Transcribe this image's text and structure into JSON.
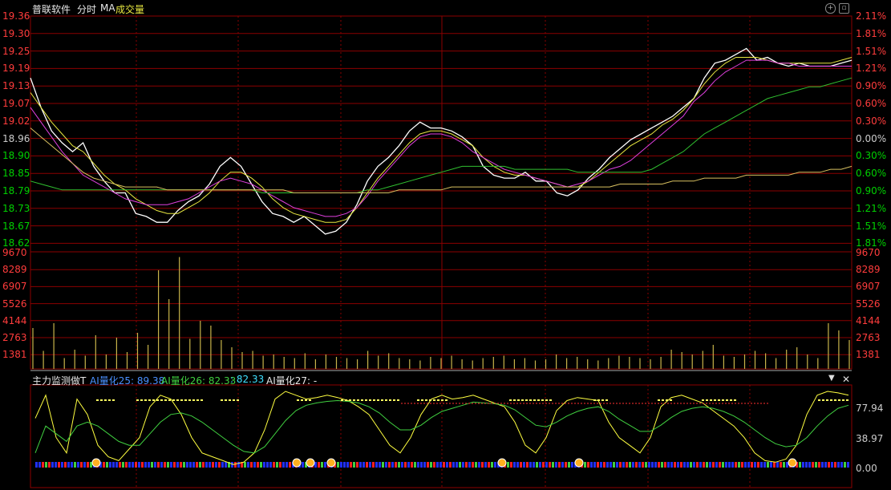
{
  "header": {
    "stock_name": "普联软件",
    "mode": "分时",
    "ma_label": "MA",
    "volume_label": "成交量",
    "settings_icon": "settings-circle-icon",
    "panel_toggle_icon": "panel-toggle-icon"
  },
  "price_axis": {
    "left_labels": [
      "19.36",
      "19.30",
      "19.25",
      "19.19",
      "19.13",
      "19.07",
      "19.02",
      "18.96",
      "18.90",
      "18.85",
      "18.79",
      "18.73",
      "18.67",
      "18.62"
    ],
    "right_labels": [
      "2.11%",
      "1.81%",
      "1.51%",
      "1.21%",
      "0.90%",
      "0.60%",
      "0.30%",
      "0.00%",
      "0.30%",
      "0.60%",
      "0.90%",
      "1.21%",
      "1.51%",
      "1.81%"
    ],
    "colors": {
      "up": "#ff3c3c",
      "flat": "#cccccc",
      "down": "#00d000"
    }
  },
  "volume_axis": {
    "labels": [
      "9670",
      "8289",
      "6907",
      "5526",
      "4144",
      "2763",
      "1381"
    ]
  },
  "indicator": {
    "name": "主力监测做T",
    "ai25_label": "AI量化25: 89.38",
    "ai26_label": "AI量化26: 82.33",
    "ai26_extra": ": 82.33",
    "ai27_label": "AI量化27: -",
    "axis_labels": [
      "77.94",
      "38.97",
      "0.00"
    ],
    "dropdown_icon": "triangle-down-icon",
    "close_icon": "close-icon"
  },
  "colors": {
    "grid": "#8b0000",
    "price_line": "#ffffff",
    "ma_yellow": "#e8e840",
    "ma_magenta": "#e040e0",
    "ma_green": "#30c030",
    "avg_yellow": "#d8c060",
    "volume_bar": "#c8b44a",
    "ind_yellow": "#ffff40",
    "ind_cyan": "#40e0ff",
    "ind_blue": "#2030ff",
    "ind_green": "#40d040"
  },
  "chart_data": {
    "type": "line",
    "title": "",
    "ylabel": "",
    "ylim": [
      18.56,
      19.36
    ],
    "prev_close": 18.96,
    "series": [
      {
        "values": [
          19.15,
          19.05,
          18.97,
          18.93,
          18.9,
          18.93,
          18.85,
          18.8,
          18.76,
          18.76,
          18.69,
          18.68,
          18.66,
          18.66,
          18.7,
          18.73,
          18.75,
          18.79,
          18.85,
          18.88,
          18.85,
          18.79,
          18.73,
          18.69,
          18.68,
          18.66,
          18.68,
          18.65,
          18.62,
          18.63,
          18.66,
          18.72,
          18.8,
          18.85,
          18.88,
          18.92,
          18.97,
          19.0,
          18.98,
          18.98,
          18.97,
          18.95,
          18.92,
          18.85,
          18.82,
          18.81,
          18.81,
          18.83,
          18.8,
          18.8,
          18.76,
          18.75,
          18.77,
          18.81,
          18.84,
          18.88,
          18.91,
          18.94,
          18.96,
          18.98,
          19.0,
          19.02,
          19.05,
          19.08,
          19.15,
          19.2,
          19.21,
          19.23,
          19.25,
          19.21,
          19.22,
          19.2,
          19.19,
          19.2,
          19.19,
          19.19,
          19.19,
          19.2,
          19.21
        ]
      },
      {
        "values": [
          19.1,
          19.05,
          19.0,
          18.96,
          18.92,
          18.9,
          18.86,
          18.82,
          18.79,
          18.77,
          18.74,
          18.72,
          18.7,
          18.69,
          18.69,
          18.71,
          18.73,
          18.76,
          18.8,
          18.83,
          18.83,
          18.81,
          18.78,
          18.74,
          18.71,
          18.69,
          18.68,
          18.67,
          18.66,
          18.66,
          18.67,
          18.71,
          18.76,
          18.81,
          18.85,
          18.89,
          18.93,
          18.96,
          18.97,
          18.97,
          18.96,
          18.94,
          18.92,
          18.88,
          18.85,
          18.83,
          18.82,
          18.82,
          18.81,
          18.8,
          18.79,
          18.78,
          18.78,
          18.8,
          18.83,
          18.86,
          18.89,
          18.92,
          18.94,
          18.96,
          18.99,
          19.01,
          19.04,
          19.08,
          19.13,
          19.17,
          19.2,
          19.22,
          19.22,
          19.22,
          19.21,
          19.2,
          19.2,
          19.2,
          19.2,
          19.2,
          19.2,
          19.21,
          19.22
        ]
      },
      {
        "values": [
          19.05,
          19.0,
          18.95,
          18.9,
          18.86,
          18.82,
          18.8,
          18.78,
          18.76,
          18.74,
          18.73,
          18.72,
          18.72,
          18.72,
          18.73,
          18.74,
          18.76,
          18.78,
          18.8,
          18.81,
          18.8,
          18.79,
          18.77,
          18.75,
          18.73,
          18.71,
          18.7,
          18.69,
          18.68,
          18.68,
          18.69,
          18.71,
          18.75,
          18.8,
          18.84,
          18.88,
          18.92,
          18.95,
          18.96,
          18.96,
          18.95,
          18.93,
          18.9,
          18.88,
          18.86,
          18.84,
          18.83,
          18.82,
          18.81,
          18.8,
          18.79,
          18.78,
          18.79,
          18.8,
          18.82,
          18.84,
          18.85,
          18.87,
          18.9,
          18.93,
          18.96,
          18.99,
          19.02,
          19.07,
          19.1,
          19.14,
          19.17,
          19.19,
          19.21,
          19.21,
          19.21,
          19.2,
          19.2,
          19.19,
          19.19,
          19.19,
          19.19,
          19.19,
          19.19
        ]
      },
      {
        "values": [
          18.8,
          18.79,
          18.78,
          18.77,
          18.77,
          18.77,
          18.77,
          18.77,
          18.77,
          18.77,
          18.77,
          18.77,
          18.77,
          18.77,
          18.77,
          18.77,
          18.77,
          18.77,
          18.77,
          18.77,
          18.77,
          18.77,
          18.76,
          18.76,
          18.76,
          18.76,
          18.76,
          18.76,
          18.76,
          18.76,
          18.76,
          18.76,
          18.77,
          18.77,
          18.78,
          18.79,
          18.8,
          18.81,
          18.82,
          18.83,
          18.84,
          18.85,
          18.85,
          18.85,
          18.85,
          18.85,
          18.84,
          18.84,
          18.84,
          18.84,
          18.84,
          18.84,
          18.83,
          18.83,
          18.83,
          18.83,
          18.83,
          18.83,
          18.83,
          18.84,
          18.86,
          18.88,
          18.9,
          18.93,
          18.96,
          18.98,
          19.0,
          19.02,
          19.04,
          19.06,
          19.08,
          19.09,
          19.1,
          19.11,
          19.12,
          19.12,
          19.13,
          19.14,
          19.15
        ]
      },
      {
        "values": [
          18.98,
          18.95,
          18.92,
          18.89,
          18.86,
          18.83,
          18.81,
          18.8,
          18.79,
          18.78,
          18.78,
          18.78,
          18.78,
          18.77,
          18.77,
          18.77,
          18.77,
          18.77,
          18.77,
          18.77,
          18.77,
          18.77,
          18.77,
          18.77,
          18.77,
          18.76,
          18.76,
          18.76,
          18.76,
          18.76,
          18.76,
          18.76,
          18.76,
          18.76,
          18.76,
          18.77,
          18.77,
          18.77,
          18.77,
          18.77,
          18.78,
          18.78,
          18.78,
          18.78,
          18.78,
          18.78,
          18.78,
          18.78,
          18.78,
          18.78,
          18.78,
          18.78,
          18.78,
          18.78,
          18.78,
          18.78,
          18.79,
          18.79,
          18.79,
          18.79,
          18.79,
          18.8,
          18.8,
          18.8,
          18.81,
          18.81,
          18.81,
          18.81,
          18.82,
          18.82,
          18.82,
          18.82,
          18.82,
          18.83,
          18.83,
          18.83,
          18.84,
          18.84,
          18.85
        ]
      }
    ],
    "volume": [
      3400,
      1500,
      3800,
      900,
      1600,
      1100,
      2800,
      1200,
      2600,
      1400,
      3000,
      2000,
      8200,
      5800,
      9300,
      2500,
      4000,
      3600,
      2400,
      1800,
      1400,
      1500,
      1100,
      1200,
      1000,
      900,
      1300,
      800,
      1200,
      1000,
      900,
      800,
      1500,
      1100,
      1300,
      900,
      800,
      700,
      1000,
      900,
      1100,
      800,
      700,
      900,
      1000,
      1100,
      800,
      900,
      700,
      800,
      1200,
      900,
      1000,
      800,
      700,
      900,
      1100,
      1000,
      900,
      800,
      1000,
      1600,
      1400,
      1200,
      1500,
      2000,
      1100,
      1000,
      1200,
      1500,
      1300,
      900,
      1600,
      1800,
      1200,
      900,
      3800,
      3200,
      2400
    ],
    "indicator_series": [
      {
        "values": [
          65,
          95,
          40,
          20,
          90,
          70,
          30,
          15,
          10,
          25,
          40,
          80,
          95,
          90,
          70,
          40,
          20,
          15,
          10,
          5,
          8,
          20,
          50,
          90,
          100,
          95,
          90,
          92,
          95,
          92,
          88,
          80,
          70,
          50,
          30,
          20,
          40,
          70,
          90,
          95,
          90,
          92,
          95,
          90,
          85,
          80,
          60,
          30,
          20,
          40,
          75,
          88,
          92,
          90,
          88,
          60,
          40,
          30,
          20,
          40,
          80,
          92,
          95,
          90,
          85,
          75,
          65,
          55,
          40,
          20,
          10,
          8,
          12,
          30,
          70,
          95,
          100,
          98,
          95
        ]
      },
      {
        "values": [
          20,
          55,
          45,
          35,
          55,
          60,
          55,
          45,
          35,
          30,
          30,
          45,
          60,
          70,
          72,
          68,
          60,
          50,
          40,
          30,
          22,
          20,
          28,
          45,
          62,
          75,
          82,
          85,
          87,
          88,
          87,
          85,
          80,
          72,
          60,
          50,
          50,
          56,
          66,
          74,
          78,
          82,
          86,
          85,
          84,
          82,
          76,
          66,
          56,
          54,
          60,
          68,
          74,
          78,
          80,
          74,
          64,
          56,
          48,
          48,
          56,
          66,
          74,
          78,
          80,
          78,
          74,
          68,
          60,
          50,
          40,
          32,
          28,
          30,
          40,
          55,
          68,
          78,
          82
        ]
      }
    ]
  }
}
